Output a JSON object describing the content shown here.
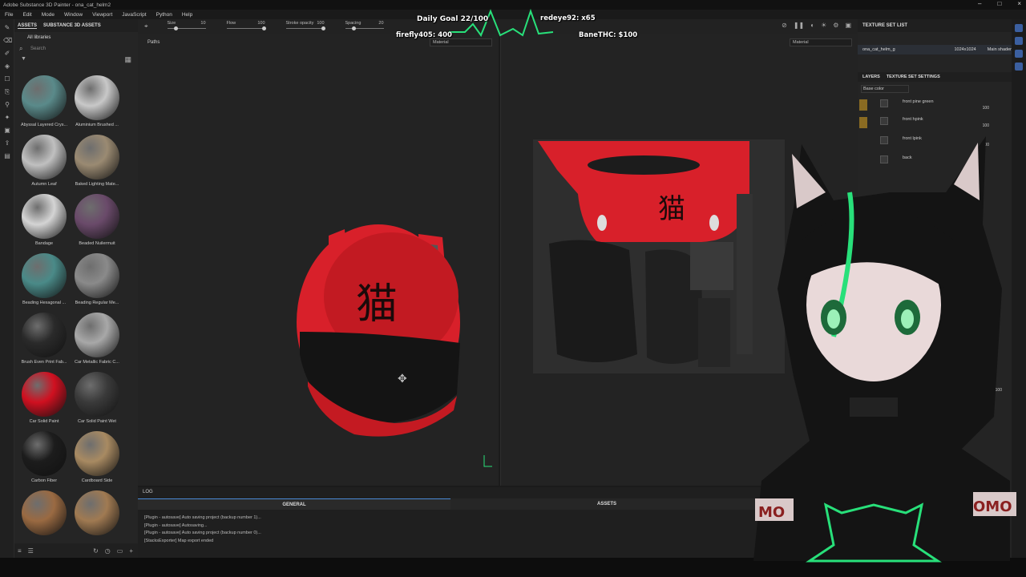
{
  "title": "Adobe Substance 3D Painter - ona_cat_helm2",
  "menu": [
    "File",
    "Edit",
    "Mode",
    "Window",
    "Viewport",
    "JavaScript",
    "Python",
    "Help"
  ],
  "assets_panel": {
    "tabs": [
      "ASSETS",
      "SUBSTANCE 3D ASSETS"
    ],
    "library": "All libraries",
    "search_placeholder": "Search",
    "items": [
      {
        "name": "Abyssal Layered Crys...",
        "color": "#5a8a8a"
      },
      {
        "name": "Aluminium Brushed ...",
        "color": "#c8c8c8"
      },
      {
        "name": "Autumn Leaf",
        "color": "#c0c0c0"
      },
      {
        "name": "Baked Lighting Mate...",
        "color": "#9a8a72"
      },
      {
        "name": "Bandage",
        "color": "#d4d4d4"
      },
      {
        "name": "Beaded Nuilermuit",
        "color": "#6a4a6a"
      },
      {
        "name": "Beading Hexagonal ...",
        "color": "#4a8a88"
      },
      {
        "name": "Beading Regular Me...",
        "color": "#8a8a8a"
      },
      {
        "name": "Brush Even Print Fab...",
        "color": "#2a2a2a"
      },
      {
        "name": "Car Metallic Fabric C...",
        "color": "#a8a8a8"
      },
      {
        "name": "Car Solid Paint",
        "color": "#d01020"
      },
      {
        "name": "Car Solid Paint Wet",
        "color": "#3a3a3a"
      },
      {
        "name": "Carbon Fiber",
        "color": "#1c1c1c"
      },
      {
        "name": "Cardboard Side",
        "color": "#a88a62"
      },
      {
        "name": "",
        "color": "#9a6a42"
      },
      {
        "name": "",
        "color": "#a07a52"
      }
    ]
  },
  "tool_props": [
    {
      "label": "Size",
      "value": "10",
      "pos": 0.2
    },
    {
      "label": "Flow",
      "value": "100",
      "pos": 1.0
    },
    {
      "label": "Stroke opacity",
      "value": "100",
      "pos": 1.0
    },
    {
      "label": "Spacing",
      "value": "20",
      "pos": 0.2
    }
  ],
  "viewport": {
    "paths": "Paths",
    "material_left": "Material",
    "material_right": "Material"
  },
  "log": {
    "header": "LOG",
    "tabs": [
      "GENERAL",
      "ASSETS"
    ],
    "lines": [
      "[Plugin - autosave] Auto saving project (backup number 1)...",
      "[Plugin - autosave] Autosaving...",
      "[Plugin - autosave] Auto saving project (backup number 0)...",
      "[StacksExporter] Map export ended"
    ]
  },
  "texture_set": {
    "header": "TEXTURE SET LIST",
    "name": "ona_cat_helm_g",
    "size": "1024x1024",
    "shader": "Main shader"
  },
  "layers": {
    "tabs": [
      "LAYERS",
      "TEXTURE SET SETTINGS"
    ],
    "channel": "Base color",
    "items": [
      {
        "name": "front pine green",
        "blend": "100"
      },
      {
        "name": "front hpink",
        "blend": "100"
      },
      {
        "name": "front lpink",
        "blend": "100"
      },
      {
        "name": "back",
        "blend": "100"
      }
    ],
    "blend_mode": "Norm",
    "blend_value": "100"
  },
  "overlay": {
    "goal": "Daily Goal 22/100",
    "user1": "redeye92: x65",
    "user2": "firefly405: 400",
    "user3": "BaneTHC: $100",
    "kanji": "猫",
    "omo": "OMO",
    "omo_left": "MO"
  },
  "colors": {
    "helmet_red": "#d8202a",
    "accent_green": "#28e07a"
  }
}
